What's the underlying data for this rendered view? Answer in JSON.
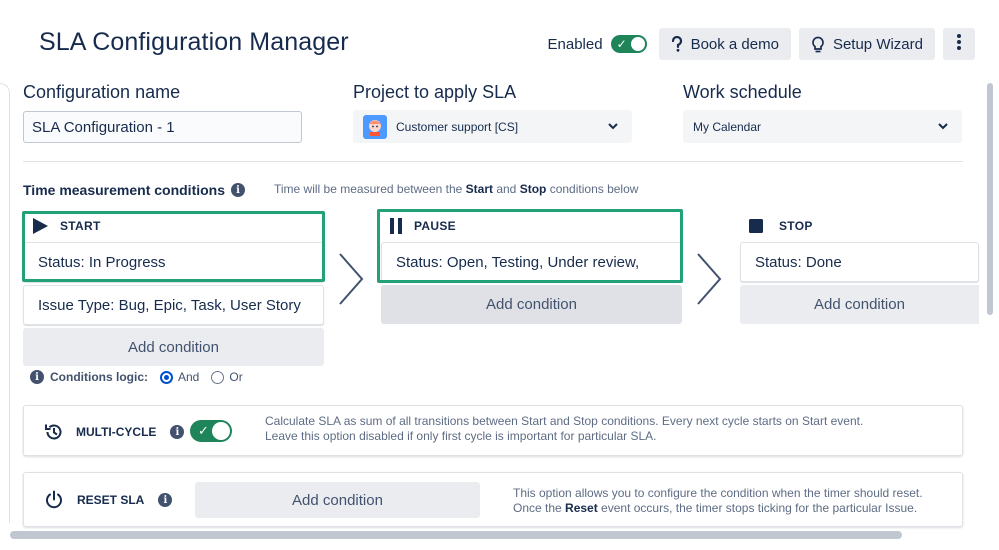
{
  "header": {
    "title": "SLA Configuration Manager",
    "enabled_label": "Enabled",
    "book_demo_label": "Book a demo",
    "setup_wizard_label": "Setup Wizard"
  },
  "fields": {
    "config_name": {
      "label": "Configuration name",
      "value": "SLA Configuration - 1"
    },
    "project": {
      "label": "Project to apply SLA",
      "value": "Customer support [CS]"
    },
    "schedule": {
      "label": "Work schedule",
      "value": "My Calendar"
    }
  },
  "conditions": {
    "title": "Time measurement conditions",
    "hint_prefix": "Time will be measured between the ",
    "hint_start": "Start",
    "hint_and": " and ",
    "hint_stop": "Stop",
    "hint_suffix": " conditions below",
    "start": {
      "label": "START",
      "items": [
        "Status: In Progress",
        "Issue Type: Bug, Epic, Task, User Story"
      ],
      "add_label": "Add condition"
    },
    "pause": {
      "label": "PAUSE",
      "items": [
        "Status: Open, Testing, Under review,"
      ],
      "add_label": "Add condition"
    },
    "stop": {
      "label": "STOP",
      "items": [
        "Status: Done"
      ],
      "add_label": "Add condition"
    },
    "logic": {
      "label": "Conditions logic:",
      "options": [
        "And",
        "Or"
      ],
      "selected": "And"
    }
  },
  "multi_cycle": {
    "label": "MULTI-CYCLE",
    "enabled": true,
    "desc_line1": "Calculate SLA as sum of all transitions between Start and Stop conditions. Every next cycle starts on Start event.",
    "desc_line2": "Leave this option disabled if only first cycle is important for particular SLA."
  },
  "reset_sla": {
    "label": "RESET SLA",
    "add_label": "Add condition",
    "desc_line1": "This option allows you to configure the condition when the timer should reset.",
    "desc_line2_prefix": "Once the ",
    "desc_line2_bold": "Reset",
    "desc_line2_suffix": " event occurs, the timer stops ticking for the particular Issue."
  },
  "colors": {
    "accent_green": "#1f845a",
    "highlight": "#22a078",
    "text": "#172b4d",
    "button_bg": "#ebecf0"
  },
  "icons": [
    "help-icon",
    "lightbulb-icon",
    "more-vertical-icon",
    "chevron-down-icon",
    "info-icon",
    "play-icon",
    "pause-icon",
    "stop-icon",
    "chevron-right-icon",
    "history-icon",
    "power-icon"
  ]
}
